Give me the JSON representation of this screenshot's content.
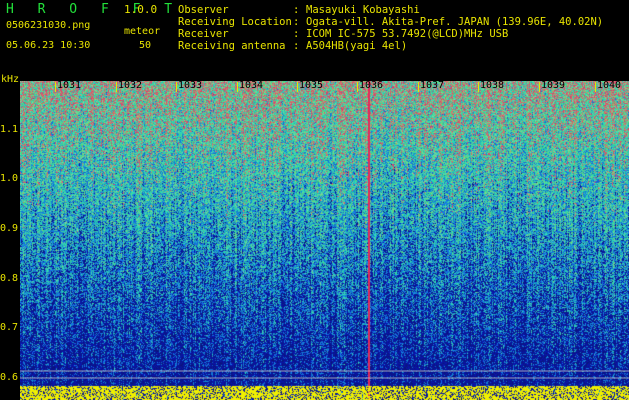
{
  "header": {
    "title": "H R O F F T",
    "version": "1.0.0",
    "filename": "0506231030.png",
    "meteor_label": "meteor",
    "datetime": "05.06.23 10:30",
    "meteor_count": "50"
  },
  "info": [
    {
      "label": "Observer",
      "value": "Masayuki Kobayashi"
    },
    {
      "label": "Receiving Location",
      "value": "Ogata-vill. Akita-Pref. JAPAN (139.96E, 40.02N)"
    },
    {
      "label": "Receiver",
      "value": "ICOM IC-575 53.7492(@LCD)MHz USB"
    },
    {
      "label": "Receiving antenna",
      "value": "A504HB(yagi 4el)"
    }
  ],
  "colon": ":",
  "chart_data": {
    "type": "heatmap",
    "ylabel": "kHz",
    "y_ticks": [
      "1.1",
      "1.0",
      "0.9",
      "0.8",
      "0.7",
      "0.6"
    ],
    "x_ticks": [
      "1031",
      "1032",
      "1033",
      "1034",
      "1035",
      "1036",
      "1037",
      "1038",
      "1039",
      "1040"
    ],
    "meteor_event_minute": "1036",
    "colors": {
      "background": "#000000",
      "low": "#0a1a9a",
      "mid": "#1e8fd0",
      "high": "#30e0a0",
      "peak": "#e03070",
      "noise_floor": "#f0f000",
      "tick": "#e8e400"
    }
  }
}
